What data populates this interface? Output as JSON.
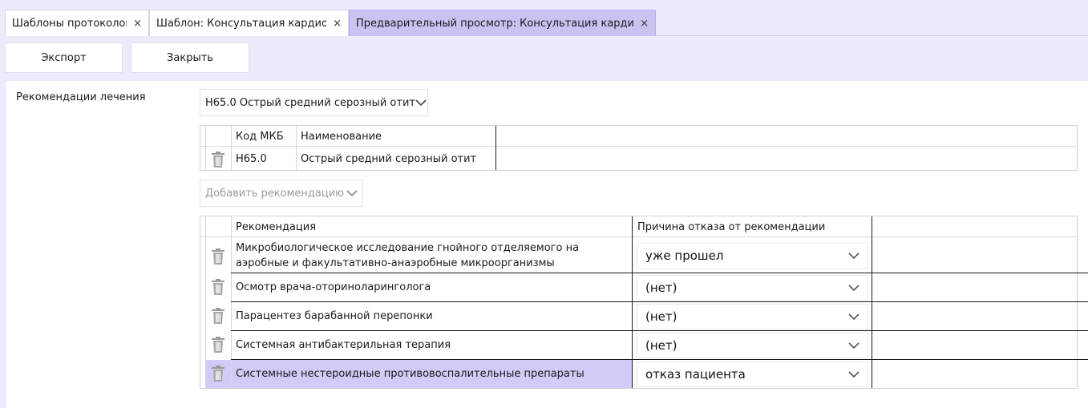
{
  "tabs": [
    {
      "label": "Шаблоны протоколов",
      "close": "×"
    },
    {
      "label": "Шаблон: Консультация кардиол...",
      "close": "×"
    },
    {
      "label": "Предварительный просмотр: Консультация кардиол...",
      "close": "×"
    }
  ],
  "toolbar": {
    "export_label": "Экспорт",
    "close_label": "Закрыть"
  },
  "section": {
    "label": "Рекомендации лечения"
  },
  "diagnosis_select": {
    "value": "H65.0 Острый средний серозный отит"
  },
  "icd_table": {
    "columns": [
      "Код МКБ",
      "Наименование"
    ],
    "rows": [
      {
        "code": "H65.0",
        "name": "Острый средний серозный отит"
      }
    ]
  },
  "add_recommendation": {
    "placeholder": "Добавить рекомендацию"
  },
  "rec_table": {
    "columns": [
      "Рекомендация",
      "Причина отказа от рекомендации"
    ],
    "rows": [
      {
        "recommendation": "Микробиологическое исследование гнойного отделяемого на аэробные и факультативно-анаэробные микроорганизмы",
        "reason": "уже прошел"
      },
      {
        "recommendation": "Осмотр врача-оториноларинголога",
        "reason": "(нет)"
      },
      {
        "recommendation": "Парацентез барабанной перепонки",
        "reason": "(нет)"
      },
      {
        "recommendation": "Системная антибактерильная терапия",
        "reason": "(нет)"
      },
      {
        "recommendation": "Системные нестероидные противовоспалительные препараты",
        "reason": "отказ пациента"
      }
    ]
  },
  "colors": {
    "frame_bg": "#edeafb",
    "active_tab": "#c9c3f2",
    "selected_row": "#d1cbf7"
  },
  "icons": {
    "tab_close": "close-icon",
    "dropdown": "chevron-down-icon",
    "delete": "trash-icon"
  }
}
